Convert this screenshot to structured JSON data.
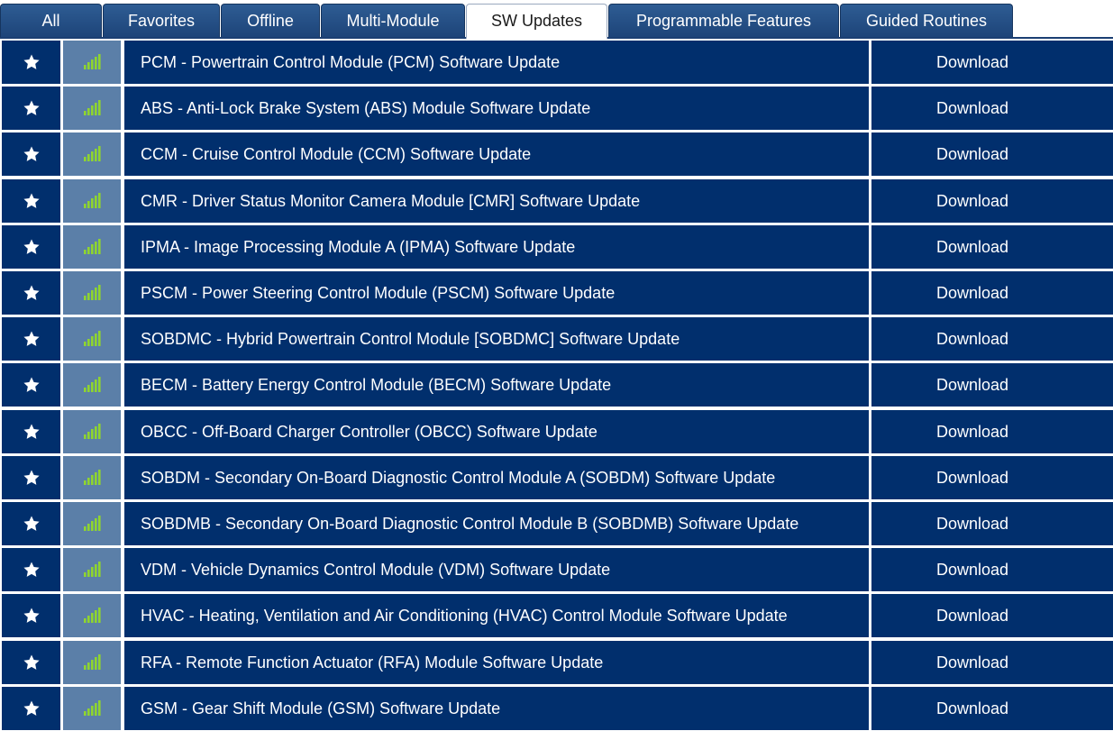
{
  "tabs": [
    {
      "label": "All",
      "active": false
    },
    {
      "label": "Favorites",
      "active": false
    },
    {
      "label": "Offline",
      "active": false
    },
    {
      "label": "Multi-Module",
      "active": false
    },
    {
      "label": "SW Updates",
      "active": true
    },
    {
      "label": "Programmable Features",
      "active": false
    },
    {
      "label": "Guided Routines",
      "active": false
    }
  ],
  "colors": {
    "row_bg": "#012f6d",
    "signal_bg": "#5b7fa8",
    "signal_bars": "#8fd52f"
  },
  "row_action_label": "Download",
  "rows": [
    {
      "name": "PCM - Powertrain Control Module (PCM) Software Update",
      "action": "Download"
    },
    {
      "name": "ABS - Anti-Lock Brake System (ABS) Module Software Update",
      "action": "Download"
    },
    {
      "name": "CCM - Cruise Control Module (CCM) Software Update",
      "action": "Download"
    },
    {
      "name": "CMR - Driver Status Monitor Camera Module [CMR] Software Update",
      "action": "Download"
    },
    {
      "name": "IPMA - Image Processing Module A (IPMA) Software Update",
      "action": "Download"
    },
    {
      "name": "PSCM - Power Steering Control Module (PSCM) Software Update",
      "action": "Download"
    },
    {
      "name": "SOBDMC - Hybrid Powertrain Control Module [SOBDMC] Software Update",
      "action": "Download"
    },
    {
      "name": "BECM - Battery Energy Control Module (BECM) Software Update",
      "action": "Download"
    },
    {
      "name": "OBCC - Off-Board Charger Controller (OBCC) Software Update",
      "action": "Download"
    },
    {
      "name": "SOBDM - Secondary On-Board Diagnostic Control Module A (SOBDM) Software Update",
      "action": "Download"
    },
    {
      "name": "SOBDMB - Secondary On-Board Diagnostic Control Module B (SOBDMB) Software Update",
      "action": "Download"
    },
    {
      "name": "VDM - Vehicle Dynamics Control Module (VDM) Software Update",
      "action": "Download"
    },
    {
      "name": "HVAC - Heating, Ventilation and Air Conditioning (HVAC) Control Module Software Update",
      "action": "Download"
    },
    {
      "name": "RFA - Remote Function Actuator (RFA) Module Software Update",
      "action": "Download"
    },
    {
      "name": "GSM - Gear Shift Module (GSM) Software Update",
      "action": "Download"
    }
  ]
}
